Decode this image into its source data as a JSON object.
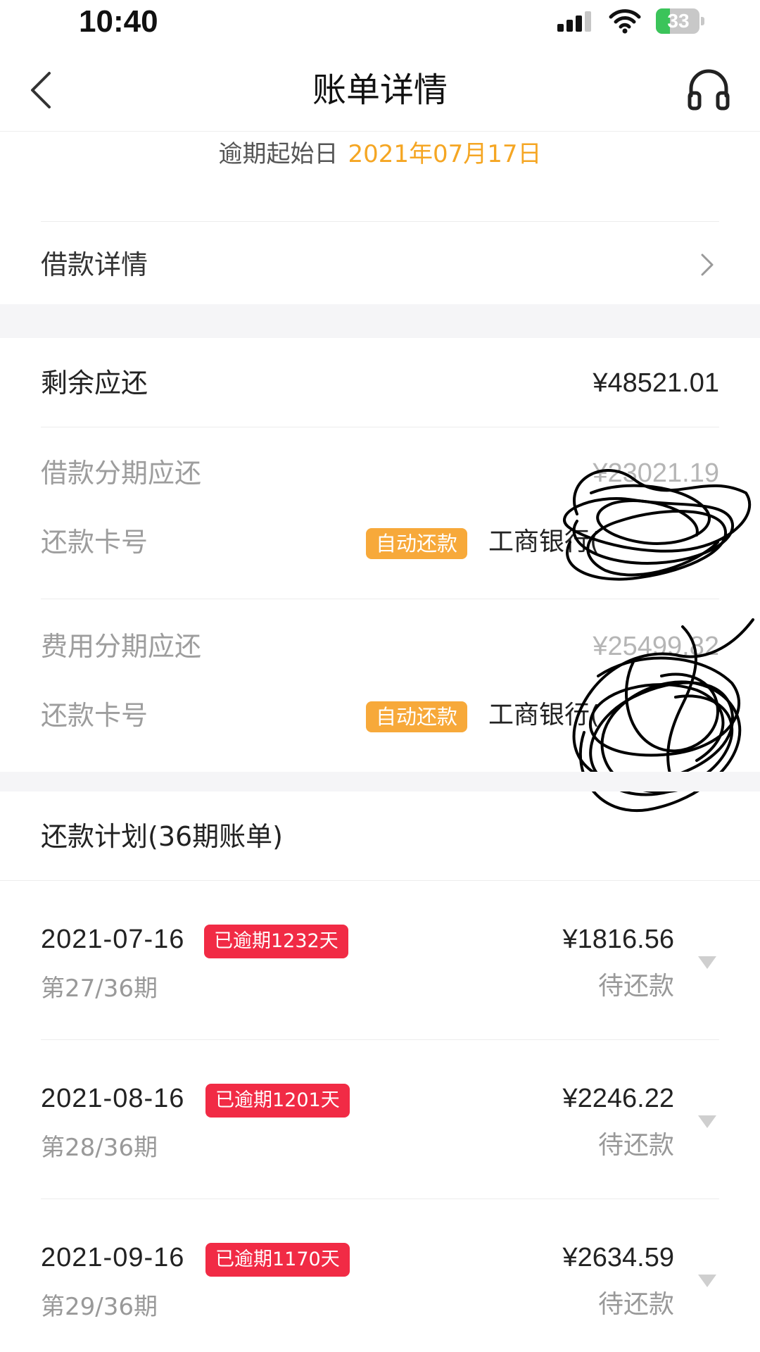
{
  "status_bar": {
    "time": "10:40",
    "battery": "33",
    "battery_level": 0.33
  },
  "nav": {
    "title": "账单详情",
    "back_icon": "chevron-left-icon",
    "support_icon": "headset-icon"
  },
  "overdue_start": {
    "label": "逾期起始日",
    "date": "2021年07月17日"
  },
  "loan_detail": {
    "label": "借款详情",
    "chevron_icon": "chevron-right-icon"
  },
  "remaining": {
    "label": "剩余应还",
    "value": "¥48521.01"
  },
  "loan_installment": {
    "label": "借款分期应还",
    "value": "¥23021.19",
    "card_label": "还款卡号",
    "auto_badge": "自动还款",
    "bank": "工商银行("
  },
  "fee_installment": {
    "label": "费用分期应还",
    "value": "¥25499.82",
    "card_label": "还款卡号",
    "auto_badge": "自动还款",
    "bank": "工商银行("
  },
  "plan": {
    "title": "还款计划(36期账单)",
    "rows": [
      {
        "date": "2021-07-16",
        "overdue": "已逾期1232天",
        "term": "第27/36期",
        "amount": "¥1816.56",
        "status": "待还款"
      },
      {
        "date": "2021-08-16",
        "overdue": "已逾期1201天",
        "term": "第28/36期",
        "amount": "¥2246.22",
        "status": "待还款"
      },
      {
        "date": "2021-09-16",
        "overdue": "已逾期1170天",
        "term": "第29/36期",
        "amount": "¥2634.59",
        "status": "待还款"
      }
    ]
  },
  "colors": {
    "accent_orange": "#f5a623",
    "badge_orange": "#f7a93a",
    "overdue_red": "#f12b45"
  }
}
